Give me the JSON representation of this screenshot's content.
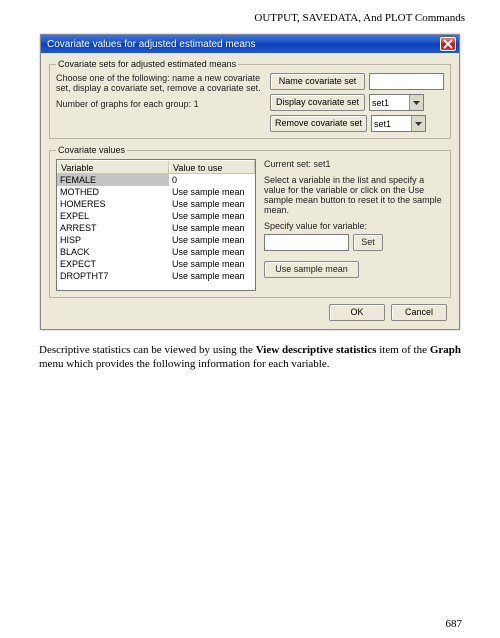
{
  "header": "OUTPUT, SAVEDATA, And PLOT Commands",
  "dialog": {
    "title": "Covariate values for adjusted estimated means",
    "group1_legend": "Covariate sets for adjusted estimated means",
    "instruction": "Choose one of the following:  name a new covariate set, display a covariate set, remove a covariate set.",
    "num_graphs_label": "Number of graphs for each group:   1",
    "btn_name": "Name covariate set",
    "btn_display": "Display covariate set",
    "btn_remove": "Remove covariate set",
    "combo_display": "set1",
    "combo_remove": "set1",
    "group2_legend": "Covariate values",
    "col_var": "Variable",
    "col_val": "Value to use",
    "rows": [
      {
        "var": "FEMALE",
        "val": "0"
      },
      {
        "var": "MOTHED",
        "val": "Use sample mean"
      },
      {
        "var": "HOMERES",
        "val": "Use sample mean"
      },
      {
        "var": "EXPEL",
        "val": "Use sample mean"
      },
      {
        "var": "ARREST",
        "val": "Use sample mean"
      },
      {
        "var": "HISP",
        "val": "Use sample mean"
      },
      {
        "var": "BLACK",
        "val": "Use sample mean"
      },
      {
        "var": "EXPECT",
        "val": "Use sample mean"
      },
      {
        "var": "DROPTHT7",
        "val": "Use sample mean"
      }
    ],
    "currset_label": "Current set: set1",
    "help_text": "Select a variable in the list and specify a value for the variable or click on the Use sample mean button to reset it to the sample mean.",
    "specify_label": "Specify value for variable:",
    "btn_set": "Set",
    "btn_sample": "Use sample mean",
    "btn_ok": "OK",
    "btn_cancel": "Cancel"
  },
  "body_text_parts": {
    "p1a": "Descriptive statistics can be viewed by using the ",
    "p1b": "View descriptive statistics",
    "p1c": " item of the ",
    "p1d": "Graph",
    "p1e": " menu  which  provides  the  following information for each variable."
  },
  "page_number": "687"
}
